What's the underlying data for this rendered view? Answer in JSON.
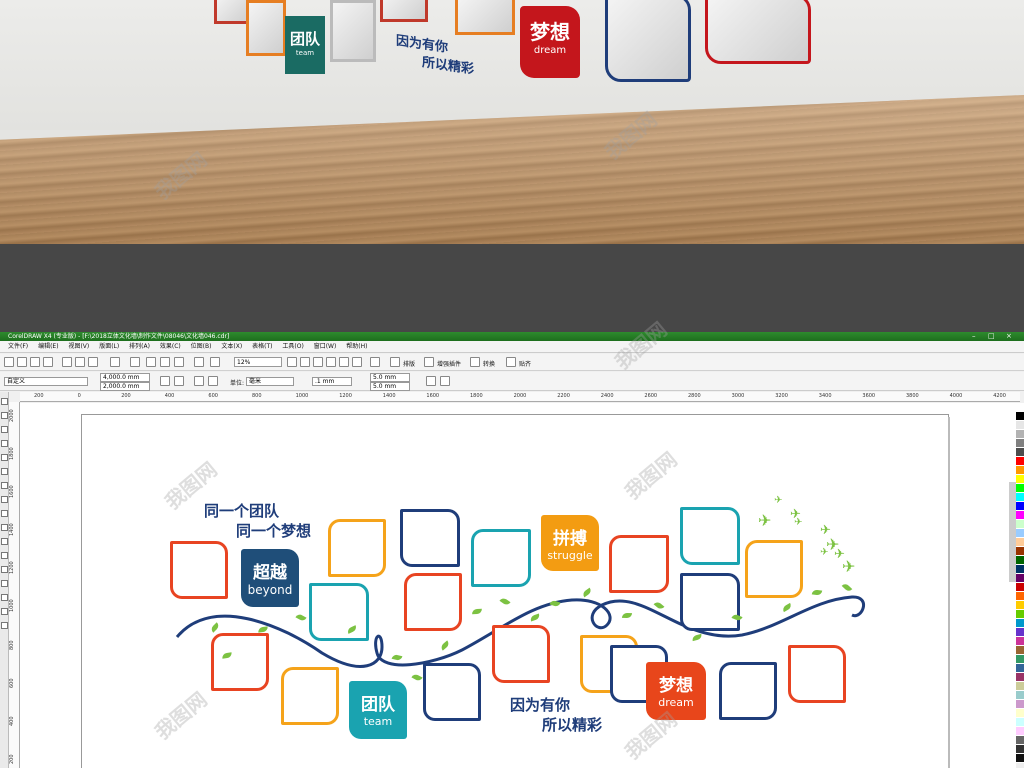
{
  "room": {
    "badges": [
      {
        "cn": "团队",
        "en": "team",
        "color": "#1a6b63"
      },
      {
        "cn": "梦想",
        "en": "dream",
        "color": "#c4161c"
      }
    ],
    "slogan": [
      "因为有你",
      "所以精彩"
    ]
  },
  "app": {
    "title": "CorelDRAW X4 (专业版) - [F:\\2018立体文化墙\\制作文件\\08046\\文化墙046.cdr]",
    "menu": [
      "文件(F)",
      "编辑(E)",
      "视图(V)",
      "版面(L)",
      "排列(A)",
      "效果(C)",
      "位图(B)",
      "文本(X)",
      "表格(T)",
      "工具(O)",
      "窗口(W)",
      "帮助(H)"
    ],
    "toolbar": {
      "zoom": "12%",
      "layout_label": "排版",
      "plugin_label": "增强插件",
      "convert_label": "转换",
      "paste_label": "贴齐"
    },
    "propbar": {
      "preset": "自定义",
      "width": "4,000.0 mm",
      "height": "2,000.0 mm",
      "unit_label": "单位:",
      "unit": "毫米",
      "nudge": ".1 mm",
      "dup_x": "5.0 mm",
      "dup_y": "5.0 mm"
    },
    "ruler_h": [
      "200",
      "0",
      "200",
      "400",
      "600",
      "800",
      "1000",
      "1200",
      "1400",
      "1600",
      "1800",
      "2000",
      "2200",
      "2400",
      "2600",
      "2800",
      "3000",
      "3200",
      "3400",
      "3600",
      "3800",
      "4000",
      "4200"
    ],
    "ruler_v": [
      "2000",
      "1800",
      "1600",
      "1400",
      "1200",
      "1000",
      "800",
      "600",
      "400",
      "200"
    ]
  },
  "design": {
    "slogan_top": [
      "同一个团队",
      "同一个梦想"
    ],
    "slogan_bottom": [
      "因为有你",
      "所以精彩"
    ],
    "badges": {
      "beyond": {
        "cn": "超越",
        "en": "beyond",
        "color": "#1f4e79"
      },
      "struggle": {
        "cn": "拼搏",
        "en": "struggle",
        "color": "#f39c12"
      },
      "team": {
        "cn": "团队",
        "en": "team",
        "color": "#1aa3b0"
      },
      "dream": {
        "cn": "梦想",
        "en": "dream",
        "color": "#e8461b"
      }
    },
    "colors": {
      "red": "#e84422",
      "orange": "#f5a31a",
      "navy": "#1f3d7a",
      "teal": "#1aa3b0",
      "green": "#7cc242"
    },
    "watermark": "我图网"
  }
}
